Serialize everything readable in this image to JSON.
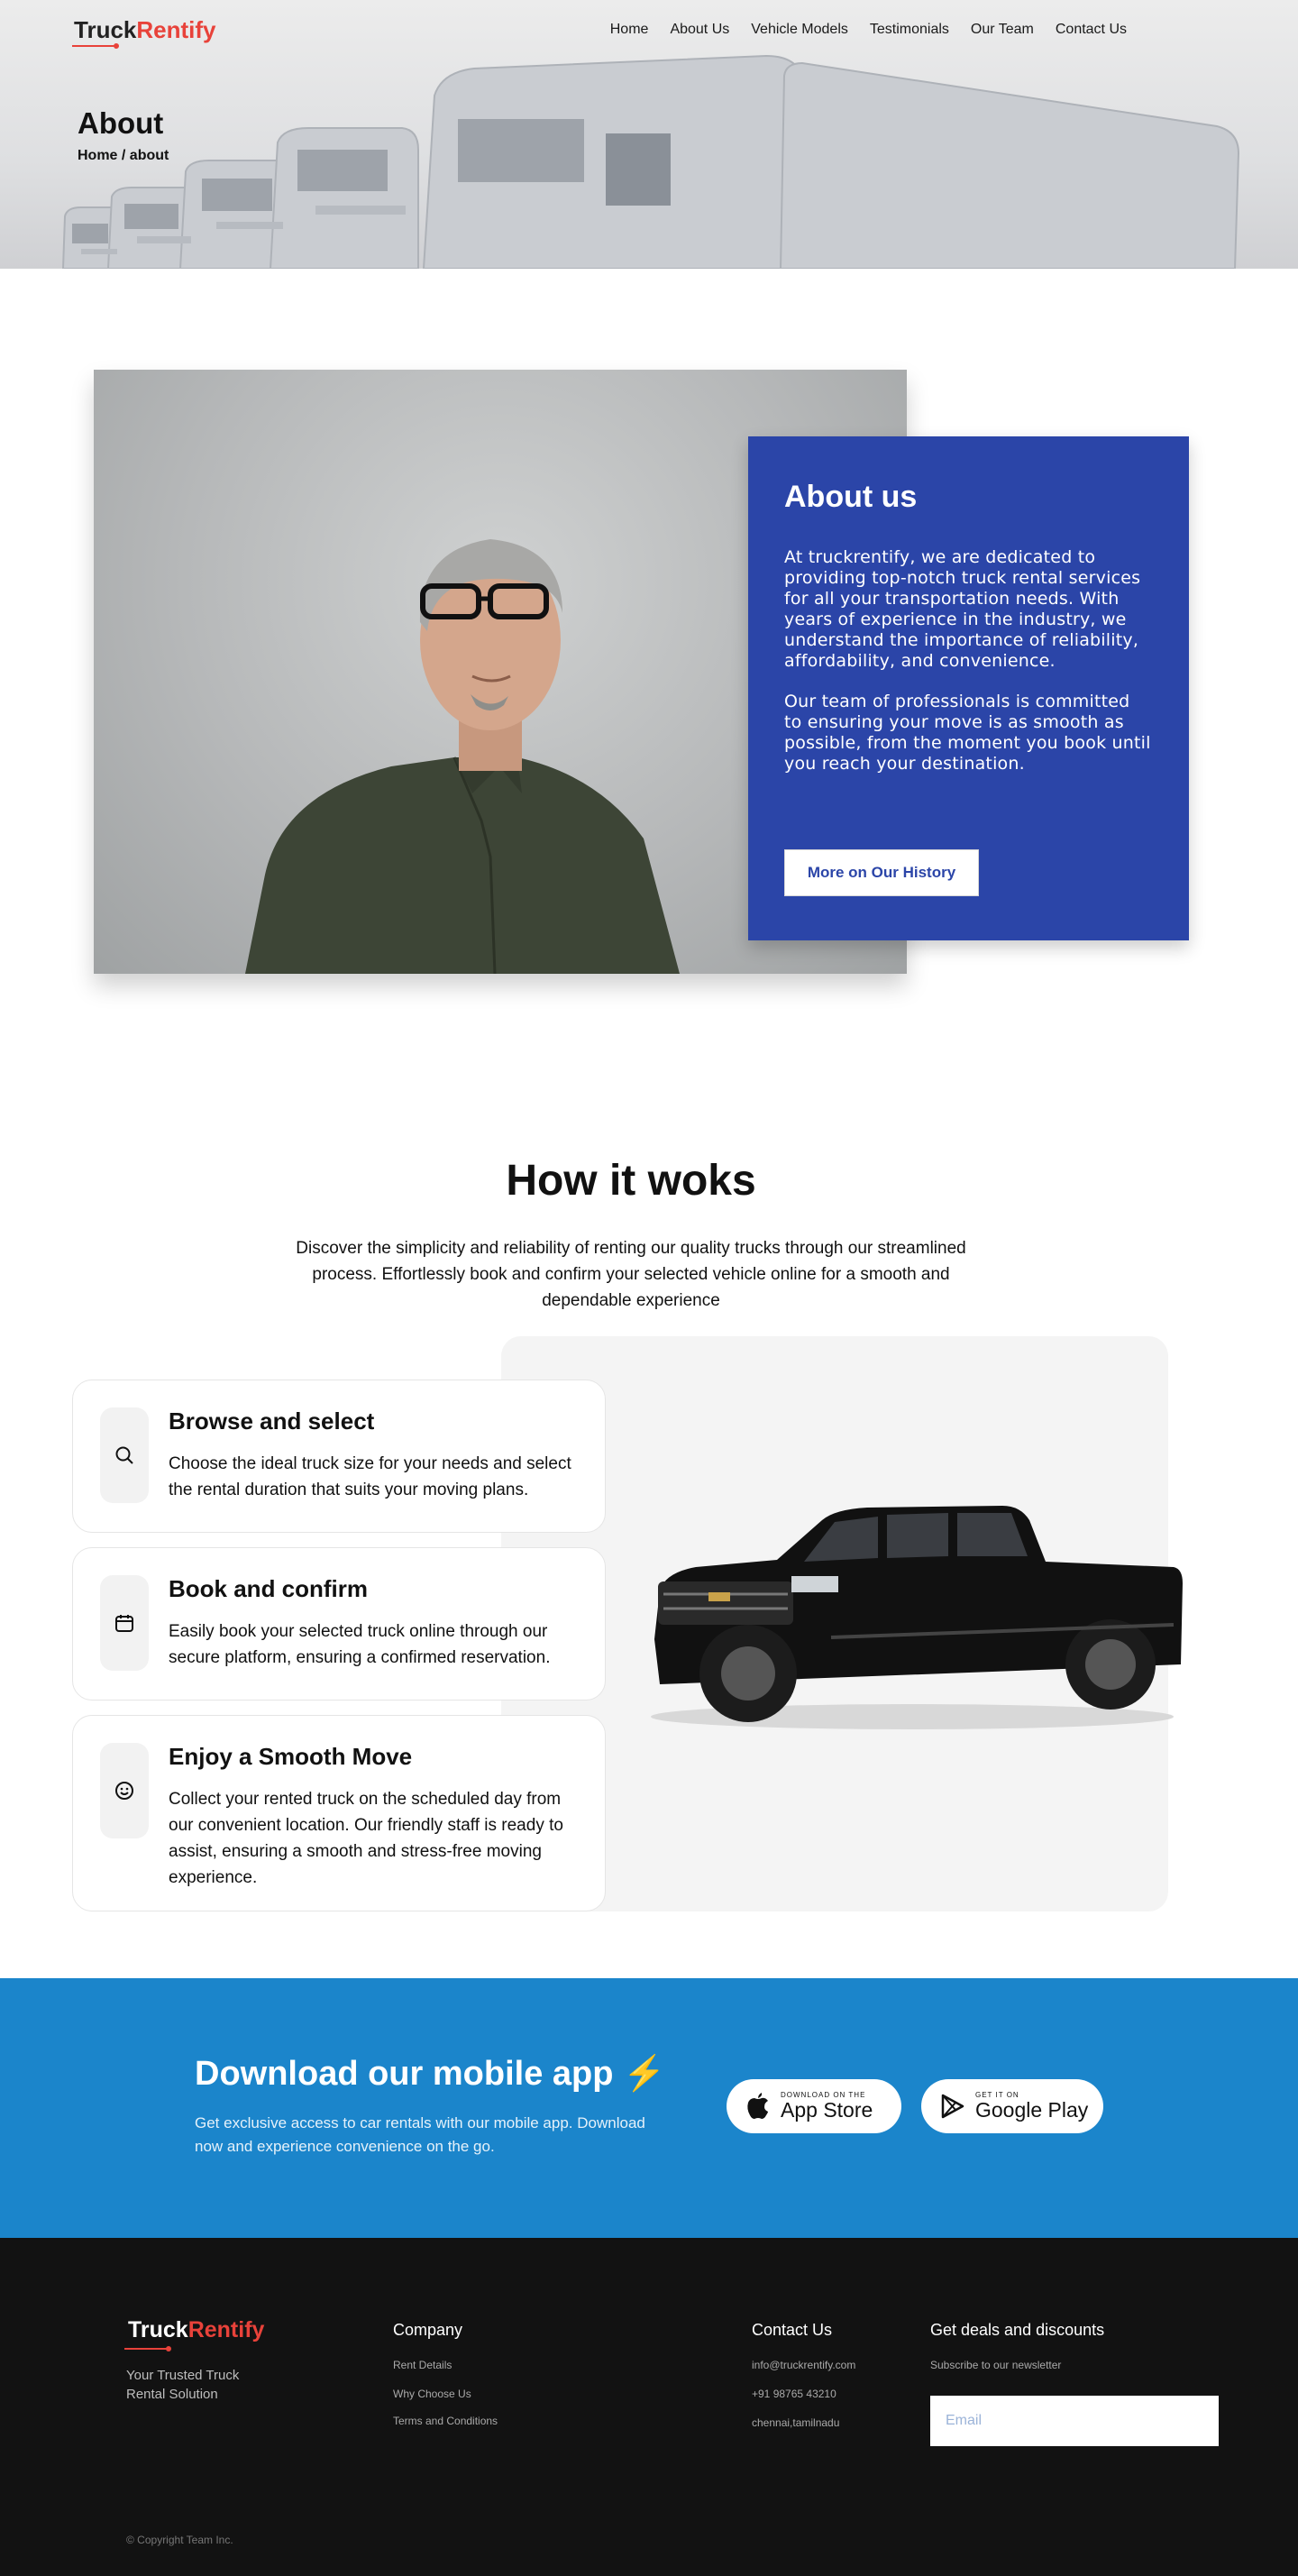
{
  "brand": {
    "part1": "Truck",
    "part2": "Rentify"
  },
  "nav": [
    "Home",
    "About Us",
    "Vehicle Models",
    "Testimonials",
    "Our Team",
    "Contact Us"
  ],
  "hero": {
    "title": "About",
    "breadcrumb": "Home / about"
  },
  "about": {
    "heading": "About us",
    "para1": "At truckrentify, we are dedicated to providing top-notch truck rental services for all your transportation needs. With years of experience in the industry, we understand the importance of reliability, affordability, and convenience.",
    "para2": " Our team of professionals is committed to ensuring your move is as smooth as possible, from the moment you book until you reach your destination.",
    "button": "More on Our History"
  },
  "how": {
    "title": "How it woks",
    "subtitle": "Discover the simplicity and reliability of renting our quality trucks through our streamlined process. Effortlessly book and confirm your selected vehicle online for a smooth and dependable experience",
    "steps": [
      {
        "icon": "search-icon",
        "title": "Browse and select",
        "text": "Choose the ideal truck size for your needs and select the rental duration that suits your moving plans."
      },
      {
        "icon": "calendar-icon",
        "title": "Book and confirm",
        "text": "Easily book your selected truck online through our secure platform, ensuring a confirmed reservation."
      },
      {
        "icon": "smiley-icon",
        "title": "Enjoy a Smooth Move",
        "text": "Collect your rented truck on the scheduled day from our convenient location. Our friendly staff is ready to assist, ensuring a smooth and stress-free moving experience."
      }
    ]
  },
  "download": {
    "title": "Download our mobile app",
    "bolt": "⚡",
    "text": "Get exclusive access to car rentals with our mobile app. Download now and experience convenience on the go.",
    "appstore_small": "DOWNLOAD ON THE",
    "appstore_big": "App Store",
    "play_small": "GET IT ON",
    "play_big": "Google Play"
  },
  "footer": {
    "tagline": "Your Trusted Truck Rental Solution",
    "company_title": "Company",
    "company_links": [
      "Rent Details",
      "Why Choose Us",
      "Terms and Conditions"
    ],
    "contact_title": "Contact Us",
    "contact": [
      "info@truckrentify.com",
      "+91 98765 43210",
      "chennai,tamilnadu"
    ],
    "deals_title": "Get deals and discounts",
    "deals_sub": "Subscribe to our newsletter",
    "email_placeholder": "Email",
    "copyright": "© Copyright Team Inc."
  },
  "colors": {
    "accent_red": "#e8423a",
    "about_blue": "#2b45a8",
    "download_blue": "#1b85cb",
    "footer_bg": "#121212"
  }
}
